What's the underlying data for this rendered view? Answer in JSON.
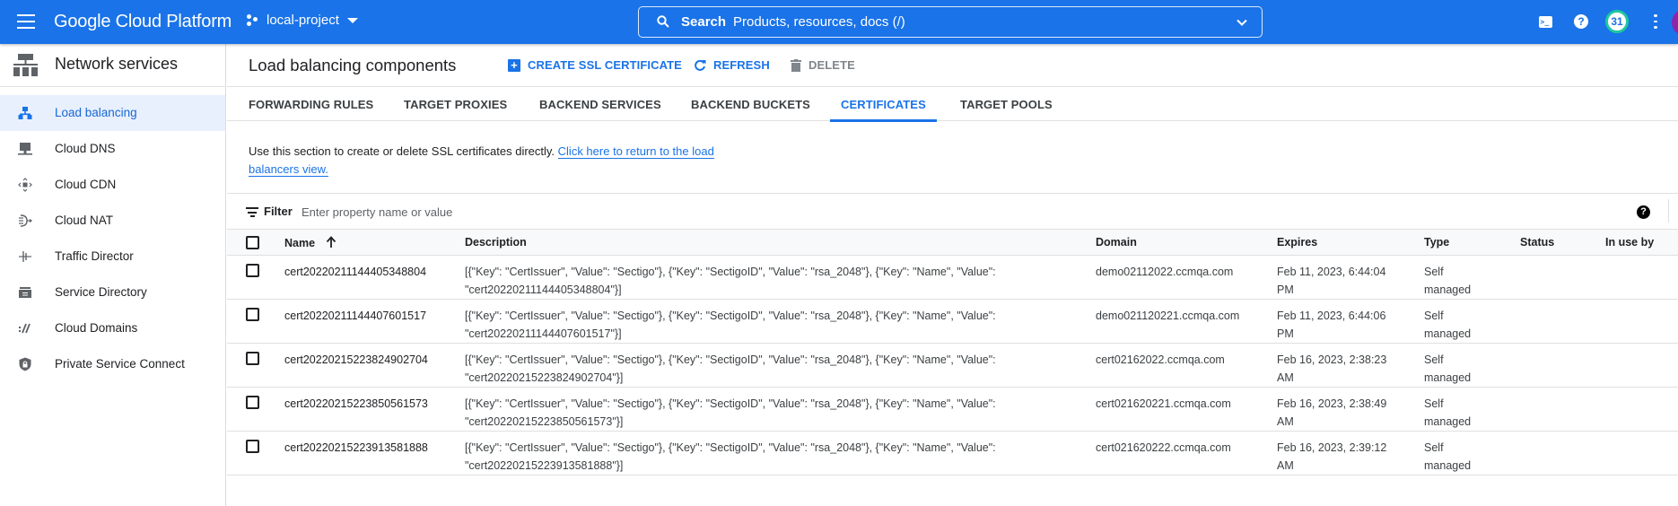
{
  "topbar": {
    "brand": "Google Cloud Platform",
    "project": "local-project",
    "search_label": "Search",
    "search_placeholder": "Products, resources, docs (/)",
    "notifications_count": "31",
    "help_glyph": "?"
  },
  "sidebar": {
    "title": "Network services",
    "items": [
      {
        "label": "Load balancing",
        "icon": "load-balancing-icon",
        "active": true
      },
      {
        "label": "Cloud DNS",
        "icon": "cloud-dns-icon",
        "active": false
      },
      {
        "label": "Cloud CDN",
        "icon": "cloud-cdn-icon",
        "active": false
      },
      {
        "label": "Cloud NAT",
        "icon": "cloud-nat-icon",
        "active": false
      },
      {
        "label": "Traffic Director",
        "icon": "traffic-director-icon",
        "active": false
      },
      {
        "label": "Service Directory",
        "icon": "service-directory-icon",
        "active": false
      },
      {
        "label": "Cloud Domains",
        "icon": "cloud-domains-icon",
        "active": false
      },
      {
        "label": "Private Service Connect",
        "icon": "private-service-connect-icon",
        "active": false
      }
    ]
  },
  "main": {
    "title": "Load balancing components",
    "actions": {
      "create": "CREATE SSL CERTIFICATE",
      "refresh": "REFRESH",
      "delete": "DELETE"
    },
    "tabs": [
      {
        "label": "FORWARDING RULES",
        "active": false
      },
      {
        "label": "TARGET PROXIES",
        "active": false
      },
      {
        "label": "BACKEND SERVICES",
        "active": false
      },
      {
        "label": "BACKEND BUCKETS",
        "active": false
      },
      {
        "label": "CERTIFICATES",
        "active": true
      },
      {
        "label": "TARGET POOLS",
        "active": false
      }
    ],
    "info_text": "Use this section to create or delete SSL certificates directly. ",
    "info_link": "Click here to return to the load balancers view.",
    "filter": {
      "label": "Filter",
      "placeholder": "Enter property name or value",
      "value": ""
    },
    "table": {
      "columns": [
        "Name",
        "Description",
        "Domain",
        "Expires",
        "Type",
        "Status",
        "In use by"
      ],
      "sort": {
        "column": "Name",
        "direction": "ascending"
      },
      "rows": [
        {
          "name": "cert20220211144405348804",
          "description_line1": "[{\"Key\": \"CertIssuer\", \"Value\": \"Sectigo\"}, {\"Key\": \"SectigoID\", \"Value\": \"rsa_2048\"}, {\"Key\": \"Name\", \"Value\":",
          "description_line2": "\"cert20220211144405348804\"}]",
          "domain": "demo02112022.ccmqa.com",
          "expires_line1": "Feb 11, 2023, 6:44:04",
          "expires_line2": "PM",
          "type_line1": "Self",
          "type_line2": "managed",
          "status": "",
          "in_use_by": ""
        },
        {
          "name": "cert20220211144407601517",
          "description_line1": "[{\"Key\": \"CertIssuer\", \"Value\": \"Sectigo\"}, {\"Key\": \"SectigoID\", \"Value\": \"rsa_2048\"}, {\"Key\": \"Name\", \"Value\":",
          "description_line2": "\"cert20220211144407601517\"}]",
          "domain": "demo021120221.ccmqa.com",
          "expires_line1": "Feb 11, 2023, 6:44:06",
          "expires_line2": "PM",
          "type_line1": "Self",
          "type_line2": "managed",
          "status": "",
          "in_use_by": ""
        },
        {
          "name": "cert20220215223824902704",
          "description_line1": "[{\"Key\": \"CertIssuer\", \"Value\": \"Sectigo\"}, {\"Key\": \"SectigoID\", \"Value\": \"rsa_2048\"}, {\"Key\": \"Name\", \"Value\":",
          "description_line2": "\"cert20220215223824902704\"}]",
          "domain": "cert02162022.ccmqa.com",
          "expires_line1": "Feb 16, 2023, 2:38:23",
          "expires_line2": "AM",
          "type_line1": "Self",
          "type_line2": "managed",
          "status": "",
          "in_use_by": ""
        },
        {
          "name": "cert20220215223850561573",
          "description_line1": "[{\"Key\": \"CertIssuer\", \"Value\": \"Sectigo\"}, {\"Key\": \"SectigoID\", \"Value\": \"rsa_2048\"}, {\"Key\": \"Name\", \"Value\":",
          "description_line2": "\"cert20220215223850561573\"}]",
          "domain": "cert021620221.ccmqa.com",
          "expires_line1": "Feb 16, 2023, 2:38:49",
          "expires_line2": "AM",
          "type_line1": "Self",
          "type_line2": "managed",
          "status": "",
          "in_use_by": ""
        },
        {
          "name": "cert20220215223913581888",
          "description_line1": "[{\"Key\": \"CertIssuer\", \"Value\": \"Sectigo\"}, {\"Key\": \"SectigoID\", \"Value\": \"rsa_2048\"}, {\"Key\": \"Name\", \"Value\":",
          "description_line2": "\"cert20220215223913581888\"}]",
          "domain": "cert021620222.ccmqa.com",
          "expires_line1": "Feb 16, 2023, 2:39:12",
          "expires_line2": "AM",
          "type_line1": "Self",
          "type_line2": "managed",
          "status": "",
          "in_use_by": ""
        }
      ]
    }
  },
  "colors": {
    "brand_blue": "#1a73e8",
    "active_bg": "#e8f0fe",
    "active_text": "#1967d2",
    "notif_ring": "#1fc7a0",
    "avatar": "#8e24aa"
  }
}
